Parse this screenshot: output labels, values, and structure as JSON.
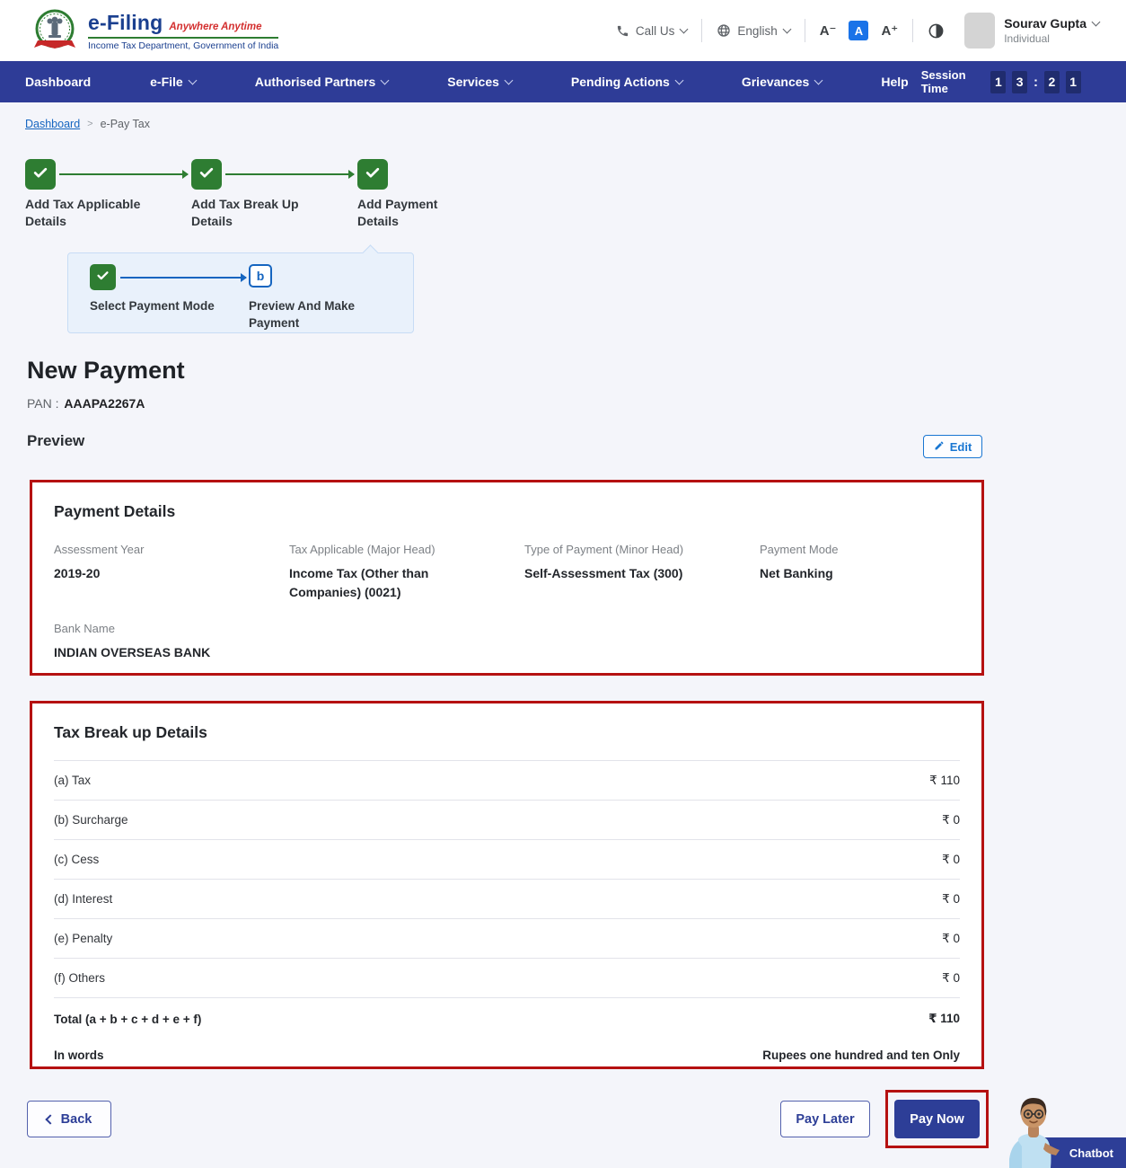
{
  "header": {
    "logo": {
      "title": "e-Filing",
      "tagline": "Anywhere Anytime",
      "subtitle": "Income Tax Department, Government of India"
    },
    "call_us": "Call Us",
    "language": "English",
    "font_controls": {
      "decrease": "A⁻",
      "normal": "A",
      "increase": "A⁺"
    },
    "user": {
      "name": "Sourav Gupta",
      "role": "Individual"
    }
  },
  "navbar": {
    "items": [
      "Dashboard",
      "e-File",
      "Authorised Partners",
      "Services",
      "Pending Actions",
      "Grievances",
      "Help"
    ],
    "session_time_label": "Session Time",
    "session_digits": [
      "1",
      "3",
      "2",
      "1"
    ],
    "session_separator": ":"
  },
  "breadcrumb": {
    "home": "Dashboard",
    "separator": ">",
    "current": "e-Pay Tax"
  },
  "stepper": {
    "steps": [
      {
        "label": "Add Tax Applicable Details"
      },
      {
        "label": "Add Tax Break Up Details"
      },
      {
        "label": "Add Payment Details"
      }
    ],
    "substeps": [
      {
        "label": "Select Payment Mode"
      },
      {
        "label": "Preview And Make Payment",
        "marker": "b"
      }
    ]
  },
  "page": {
    "title": "New Payment",
    "pan_label": "PAN :",
    "pan_value": "AAAPA2267A",
    "preview_label": "Preview",
    "edit_label": "Edit"
  },
  "payment_details": {
    "title": "Payment Details",
    "fields": [
      {
        "label": "Assessment Year",
        "value": "2019-20"
      },
      {
        "label": "Tax Applicable (Major Head)",
        "value": "Income Tax (Other than Companies) (0021)"
      },
      {
        "label": "Type of Payment (Minor Head)",
        "value": "Self-Assessment Tax (300)"
      },
      {
        "label": "Payment Mode",
        "value": "Net Banking"
      },
      {
        "label": "Bank Name",
        "value": "INDIAN OVERSEAS BANK"
      }
    ]
  },
  "tax_breakup": {
    "title": "Tax Break up Details",
    "rows": [
      {
        "label": "(a) Tax",
        "value": "₹ 110"
      },
      {
        "label": "(b) Surcharge",
        "value": "₹ 0"
      },
      {
        "label": "(c) Cess",
        "value": "₹ 0"
      },
      {
        "label": "(d) Interest",
        "value": "₹ 0"
      },
      {
        "label": "(e) Penalty",
        "value": "₹ 0"
      },
      {
        "label": "(f) Others",
        "value": "₹ 0"
      }
    ],
    "total": {
      "label": "Total (a + b + c + d + e + f)",
      "value": "₹ 110"
    },
    "in_words": {
      "label": "In words",
      "value": "Rupees one hundred and ten Only"
    }
  },
  "actions": {
    "back": "Back",
    "pay_later": "Pay Later",
    "pay_now": "Pay Now"
  },
  "chatbot": {
    "label": "Chatbot"
  },
  "colors": {
    "navbar": "#2e3c97",
    "accent_green": "#2e7d32",
    "accent_blue": "#1565c0",
    "highlight_red": "#b51111"
  }
}
